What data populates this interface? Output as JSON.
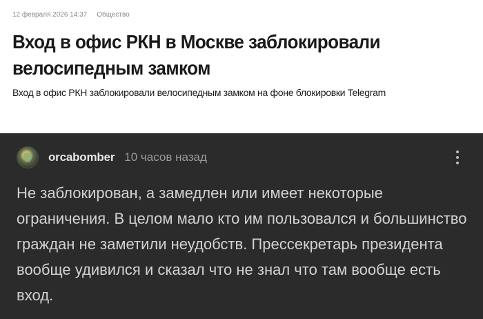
{
  "article": {
    "date": "12 февраля 2026 14:37",
    "category": "Общество",
    "title": "Вход в офис РКН в Москве заблокировали велосипедным замком",
    "lead": "Вход в офис РКН заблокировали велосипедным замком на фоне блокировки Telegram"
  },
  "comment": {
    "username": "orcabomber",
    "time": "10 часов назад",
    "text": "Не заблокирован, а замедлен или имеет некоторые ограничения. В целом мало кто им пользовался и большинство граждан не заметили неудобств. Прессекретарь президента вообще удивился и сказал что не знал что там вообще есть вход.",
    "menu_icon": "more-vertical-icon"
  },
  "colors": {
    "article_bg": "#ffffff",
    "comment_bg": "#2b2b2b",
    "comment_text": "#d2d2d2",
    "muted": "#9a9a9a"
  }
}
